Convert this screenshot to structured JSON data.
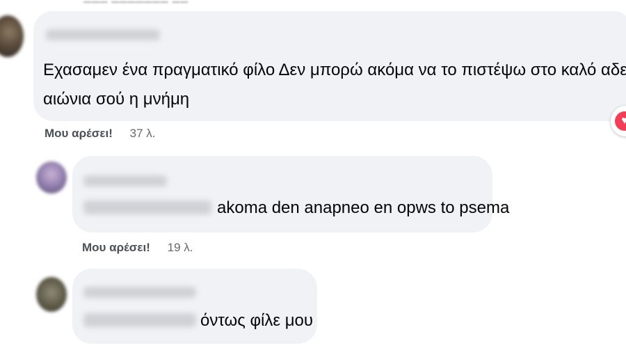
{
  "comments": [
    {
      "text_line1": "Εχασαμεν ένα πραγματικό φίλο Δεν μπορώ ακόμα να το πιστέψω στο καλό αδελφέ",
      "text_line2": "αιώνια σού η μνήμη",
      "like_label": "Μου αρέσει!",
      "time": "37 λ."
    },
    {
      "text": "akoma den anapneo en opws to psema",
      "like_label": "Μου αρέσει!",
      "time": "19 λ."
    },
    {
      "text": "όντως φίλε μου"
    }
  ],
  "reaction": {
    "icon": "heart-icon",
    "color": "#f33e58"
  },
  "colors": {
    "bubble": "#f0f2f5",
    "meta": "#65676b"
  }
}
